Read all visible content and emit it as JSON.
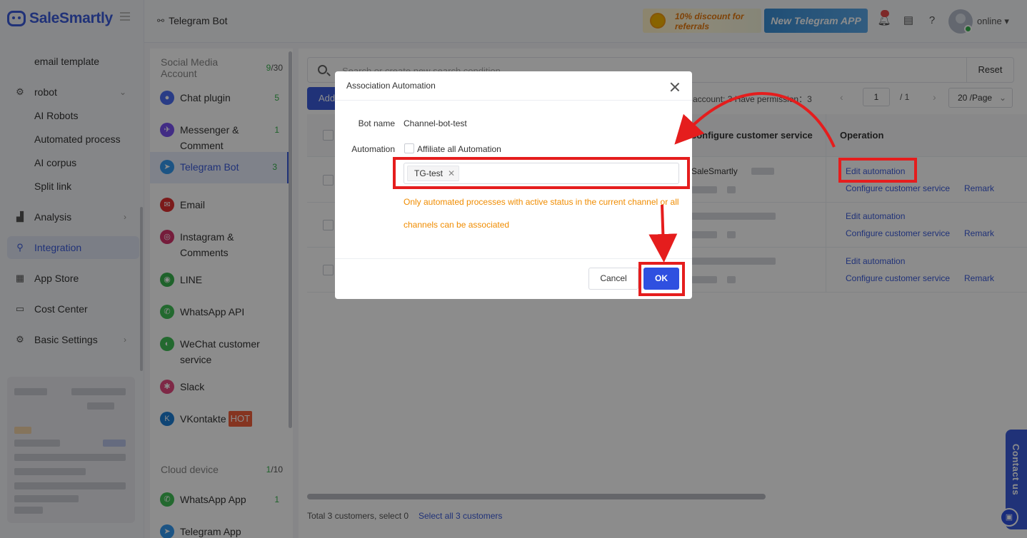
{
  "app": {
    "brand": "SaleSmartly",
    "accent_color": "#3b5bdb"
  },
  "sidebar": {
    "sub_items_top": [
      "email template"
    ],
    "robot": {
      "label": "robot",
      "items": [
        "AI Robots",
        "Automated process",
        "AI corpus",
        "Split link"
      ]
    },
    "menu": [
      {
        "label": "Analysis",
        "icon": "chart-icon"
      },
      {
        "label": "Integration",
        "icon": "integration-icon",
        "active": true
      },
      {
        "label": "App Store",
        "icon": "grid-icon"
      },
      {
        "label": "Cost Center",
        "icon": "wallet-icon"
      },
      {
        "label": "Basic Settings",
        "icon": "gear-icon"
      }
    ]
  },
  "header": {
    "breadcrumb": "Telegram Bot",
    "promo_text": "10% discount for referrals",
    "telegram_app_banner": "New Telegram APP",
    "status": "online"
  },
  "channels": {
    "social_header": "Social Media Account",
    "social_used": "9",
    "social_total": "/30",
    "items": [
      {
        "label": "Chat plugin",
        "count": "5",
        "color": "#4c6ef5"
      },
      {
        "label": "Messenger & Comment",
        "count": "1",
        "color": "#7950f2"
      },
      {
        "label": "Telegram Bot",
        "count": "3",
        "color": "#339af0",
        "active": true
      },
      {
        "label": "Email",
        "count": "",
        "color": "#e03131"
      },
      {
        "label": "Instagram & Comments",
        "count": "",
        "color": "#d6336c"
      },
      {
        "label": "LINE",
        "count": "",
        "color": "#37b24d"
      },
      {
        "label": "WhatsApp API",
        "count": "",
        "color": "#40c057"
      },
      {
        "label": "WeChat customer service",
        "count": "",
        "color": "#40c057"
      },
      {
        "label": "Slack",
        "count": "",
        "color": "#e64980"
      },
      {
        "label": "VKontakte",
        "count": "",
        "color": "#1c7ed6",
        "badge": "HOT"
      }
    ],
    "cloud_header": "Cloud device",
    "cloud_used": "1",
    "cloud_total": "/10",
    "cloud_items": [
      {
        "label": "WhatsApp App",
        "count": "1",
        "color": "#40c057"
      },
      {
        "label": "Telegram App",
        "count": "",
        "color": "#339af0"
      }
    ]
  },
  "main": {
    "search_placeholder": "Search or create new search condition",
    "reset_label": "Reset",
    "add_label": "Add",
    "account_info": "tal account: 3   Have permission：3",
    "page_current": "1",
    "page_total": "/   1",
    "per_page": "20 /Page",
    "columns": [
      "configure customer service",
      "Operation"
    ],
    "first_row_service": "SaleSmartly",
    "row_actions": {
      "edit": "Edit automation",
      "configure": "Configure customer service",
      "remark": "Remark"
    },
    "rows": 3,
    "footer_total": "Total 3 customers, select 0",
    "footer_select_all": "Select all 3 customers"
  },
  "modal": {
    "title": "Association Automation",
    "bot_name_label": "Bot name",
    "bot_name_value": "Channel-bot-test",
    "automation_label": "Automation",
    "affiliate_all_label": "Affiliate all Automation",
    "selected_tag": "TG-test",
    "hint_line1": "Only automated processes with active status in the current channel or all",
    "hint_line2": "channels can be associated",
    "cancel_label": "Cancel",
    "ok_label": "OK"
  },
  "contact_us": "Contact us",
  "annotation_color": "#e51d1d"
}
